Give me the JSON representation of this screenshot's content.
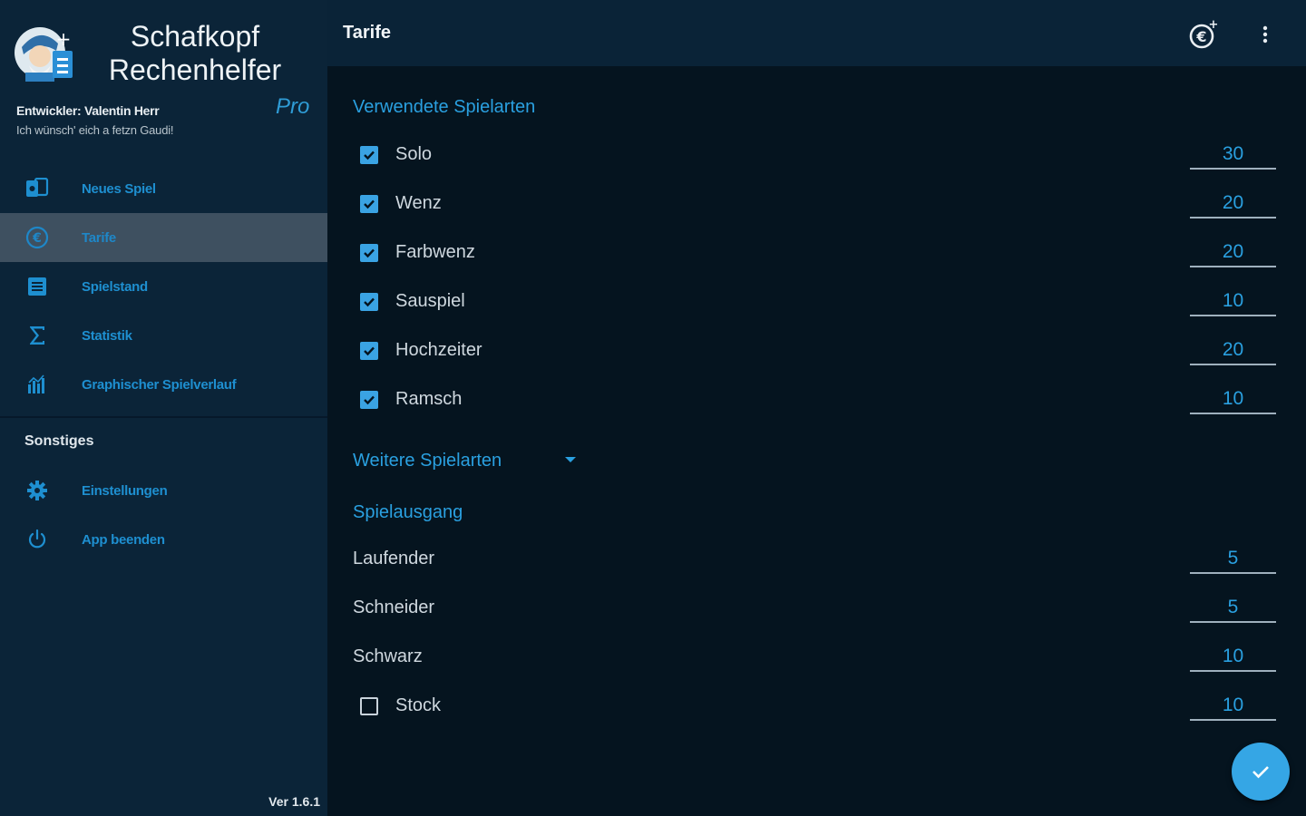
{
  "app": {
    "title_line1": "Schafkopf",
    "title_line2": "Rechenhelfer",
    "pro_label": "Pro",
    "developer": "Entwickler: Valentin Herr",
    "slogan": "Ich wünsch' eich a fetzn Gaudi!",
    "version": "Ver 1.6.1"
  },
  "sidebar": {
    "items": [
      {
        "label": "Neues Spiel",
        "icon": "cards-icon"
      },
      {
        "label": "Tarife",
        "icon": "euro-icon",
        "active": true
      },
      {
        "label": "Spielstand",
        "icon": "list-icon"
      },
      {
        "label": "Statistik",
        "icon": "sigma-icon"
      },
      {
        "label": "Graphischer Spielverlauf",
        "icon": "bar-chart-icon"
      }
    ],
    "section_title": "Sonstiges",
    "other_items": [
      {
        "label": "Einstellungen",
        "icon": "gear-icon"
      },
      {
        "label": "App beenden",
        "icon": "power-icon"
      }
    ]
  },
  "topbar": {
    "title": "Tarife"
  },
  "main": {
    "section_used": "Verwendete Spielarten",
    "games": [
      {
        "label": "Solo",
        "value": "30",
        "checked": true
      },
      {
        "label": "Wenz",
        "value": "20",
        "checked": true
      },
      {
        "label": "Farbwenz",
        "value": "20",
        "checked": true
      },
      {
        "label": "Sauspiel",
        "value": "10",
        "checked": true
      },
      {
        "label": "Hochzeiter",
        "value": "20",
        "checked": true
      },
      {
        "label": "Ramsch",
        "value": "10",
        "checked": true
      }
    ],
    "section_more": "Weitere Spielarten",
    "section_outcome": "Spielausgang",
    "outcomes": [
      {
        "label": "Laufender",
        "value": "5"
      },
      {
        "label": "Schneider",
        "value": "5"
      },
      {
        "label": "Schwarz",
        "value": "10"
      }
    ],
    "stock": {
      "label": "Stock",
      "value": "10",
      "checked": false
    }
  },
  "colors": {
    "accent": "#2aa0e0",
    "sidebar_bg": "#0b2438",
    "content_bg": "#05141f",
    "active_item": "#3e5060"
  }
}
